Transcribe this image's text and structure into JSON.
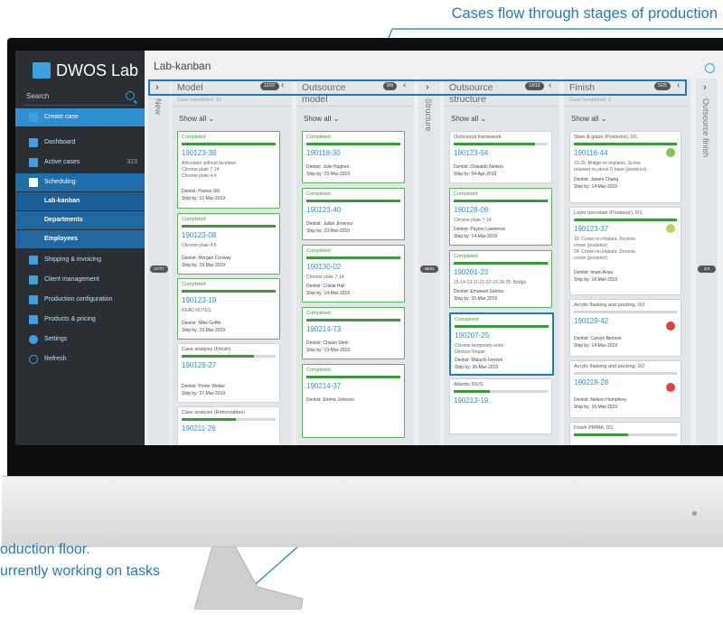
{
  "callouts": {
    "top": "Cases flow through stages of production",
    "bottom_line1": "oduction floor.",
    "bottom_line2": "urrently working on tasks"
  },
  "app": {
    "logo": "DWOS Lab",
    "search_placeholder": "Search",
    "page_title": "Lab-kanban"
  },
  "sidebar": {
    "create": "Create case",
    "items": [
      {
        "label": "Dashboard",
        "icon": "dashboard-icon"
      },
      {
        "label": "Active cases",
        "icon": "cases-icon",
        "count": "323"
      },
      {
        "label": "Scheduling",
        "icon": "calendar-icon"
      },
      {
        "label": "Shipping & invoicing",
        "icon": "truck-icon"
      },
      {
        "label": "Client management",
        "icon": "person-icon"
      },
      {
        "label": "Production configuration",
        "icon": "factory-icon"
      },
      {
        "label": "Products & pricing",
        "icon": "price-tag-icon"
      },
      {
        "label": "Settings",
        "icon": "gear-icon"
      },
      {
        "label": "Refresh",
        "icon": "refresh-icon"
      }
    ],
    "sub": [
      "Lab-kanban",
      "Departments",
      "Employees"
    ]
  },
  "columns": {
    "new": {
      "label": "New",
      "count": "37/37"
    },
    "model": {
      "title": "Model",
      "sub": "Case completed: 12",
      "pill": "12/37",
      "show": "Show all"
    },
    "outsource_model": {
      "title": "Outsource",
      "title2": "model",
      "pill": "9/9",
      "show": "Show all"
    },
    "structure": {
      "label": "Structure",
      "count": "45/51"
    },
    "outsource_structure": {
      "title": "Outsource",
      "title2": "structure",
      "pill": "13/13",
      "show": "Show all"
    },
    "finish": {
      "title": "Finish",
      "sub": "Case completed: 3",
      "pill": "5/25",
      "show": "Show all"
    },
    "outsource_finish": {
      "label": "Outsource finish",
      "count": "3/3"
    }
  },
  "cards": {
    "model": [
      {
        "status": "Completed",
        "id": "190123-38",
        "desc": "Articulator without facebow\nChrome plate 7-14\nChrome plate 4-6",
        "dentist": "Dentist: Hanna Gill",
        "ship": "Ship by: 12-Mar-2019"
      },
      {
        "status": "Completed",
        "id": "190123-08",
        "desc": "Chrome plate 4-6",
        "dentist": "Dentist: Morgan Conway",
        "ship": "Ship by: 19-Mar-2019"
      },
      {
        "status": "Completed",
        "id": "190123-19",
        "desc": "READ NOTES",
        "dentist": "Dentist: Mike Griffin",
        "ship": "Ship by: 19-Mar-2019"
      },
      {
        "status": "Case analysis (Finish)",
        "id": "190129-27",
        "desc": "",
        "dentist": "Dentist: Porter Weber",
        "ship": "Ship by: 27-Mar-2019"
      },
      {
        "status": "Case analysis (Removables)",
        "id": "190211-26",
        "desc": "",
        "dentist": "",
        "ship": ""
      }
    ],
    "outsource_model": [
      {
        "status": "Completed",
        "id": "190118-30",
        "desc": "",
        "dentist": "Dentist: Julie Hughes",
        "ship": "Ship by: 23-Mar-2019"
      },
      {
        "status": "Completed",
        "id": "190123-40",
        "desc": "",
        "dentist": "Dentist: Julian Jimenez",
        "ship": "Ship by: 23-Mar-2019"
      },
      {
        "status": "Completed",
        "id": "190130-02",
        "desc": "Chrome plate 7-14",
        "dentist": "Dentist: Cristal Hall",
        "ship": "Ship by: 14-Mar-2019"
      },
      {
        "status": "Completed",
        "id": "190214-73",
        "desc": "",
        "dentist": "Dentist: Chasin Stein",
        "ship": "Ship by: 13-Mar-2019"
      },
      {
        "status": "Completed",
        "id": "190214-37",
        "desc": "",
        "dentist": "Dentist: Emma Johnson",
        "ship": ""
      }
    ],
    "outsource_structure": [
      {
        "status": "Outsource framework",
        "id": "190123-54",
        "desc": "",
        "dentist": "Dentist: Oswaldo Nelson",
        "ship": "Ship by: 04-Apr-2019"
      },
      {
        "status": "Completed",
        "id": "190128-09",
        "desc": "Chrome plate 7-14",
        "dentist": "Dentist: Payton Lawrence",
        "ship": "Ship by: 14-Mar-2019"
      },
      {
        "status": "Completed",
        "id": "190201-23",
        "desc": "15-14-13-11-21-22-23-24-25: Bridge",
        "dentist": "Dentist: Emanuel Santos",
        "ship": "Ship by: 15-Mar-2019"
      },
      {
        "status": "Completed",
        "id": "190207-25",
        "desc": "Chrome temporary ends\nDenture Repair",
        "dentist": "Dentist: Malachi Iverson",
        "ship": "Ship by: 26-Mar-2019"
      },
      {
        "status": "Atlantis ISUS",
        "id": "190213-19",
        "desc": "",
        "dentist": "",
        "ship": ""
      }
    ],
    "finish": [
      {
        "status": "Stain & glaze (Posterior), 0/1",
        "id": "190116-44",
        "desc": "23-26: Bridge on implants, Screw\nretained on stock Ti-base (posterior)",
        "dentist": "Dentist: Janani Chang",
        "ship": "Ship by: 14-Mar-2019"
      },
      {
        "status": "Layer porcelain (Posterior), 0/1",
        "id": "190123-37",
        "desc": "15: Crown on implant, Zirconia\ncrown (posterior)\n24: Crown on implant, Zirconia\ncrown (posterior)",
        "dentist": "Dentist: Imani Arias",
        "ship": "Ship by: 18-Mar-2019"
      },
      {
        "status": "Acrylic flasking and packing, 0/2",
        "id": "190129-42",
        "desc": "",
        "dentist": "Dentist: Carsyn Benson",
        "ship": "Ship by: 14-Mar-2019"
      },
      {
        "status": "Acrylic flasking and packing, 0/2",
        "id": "190218-28",
        "desc": "",
        "dentist": "Dentist: Nelson Humphrey",
        "ship": "Ship by: 16-Mar-2019"
      },
      {
        "status": "Finish PMMA, 0/1",
        "id": "",
        "desc": "",
        "dentist": "",
        "ship": ""
      }
    ]
  },
  "colors": {
    "accent": "#1f79bf",
    "sidebar": "#2b2e33",
    "complete": "#3a9b3a"
  }
}
